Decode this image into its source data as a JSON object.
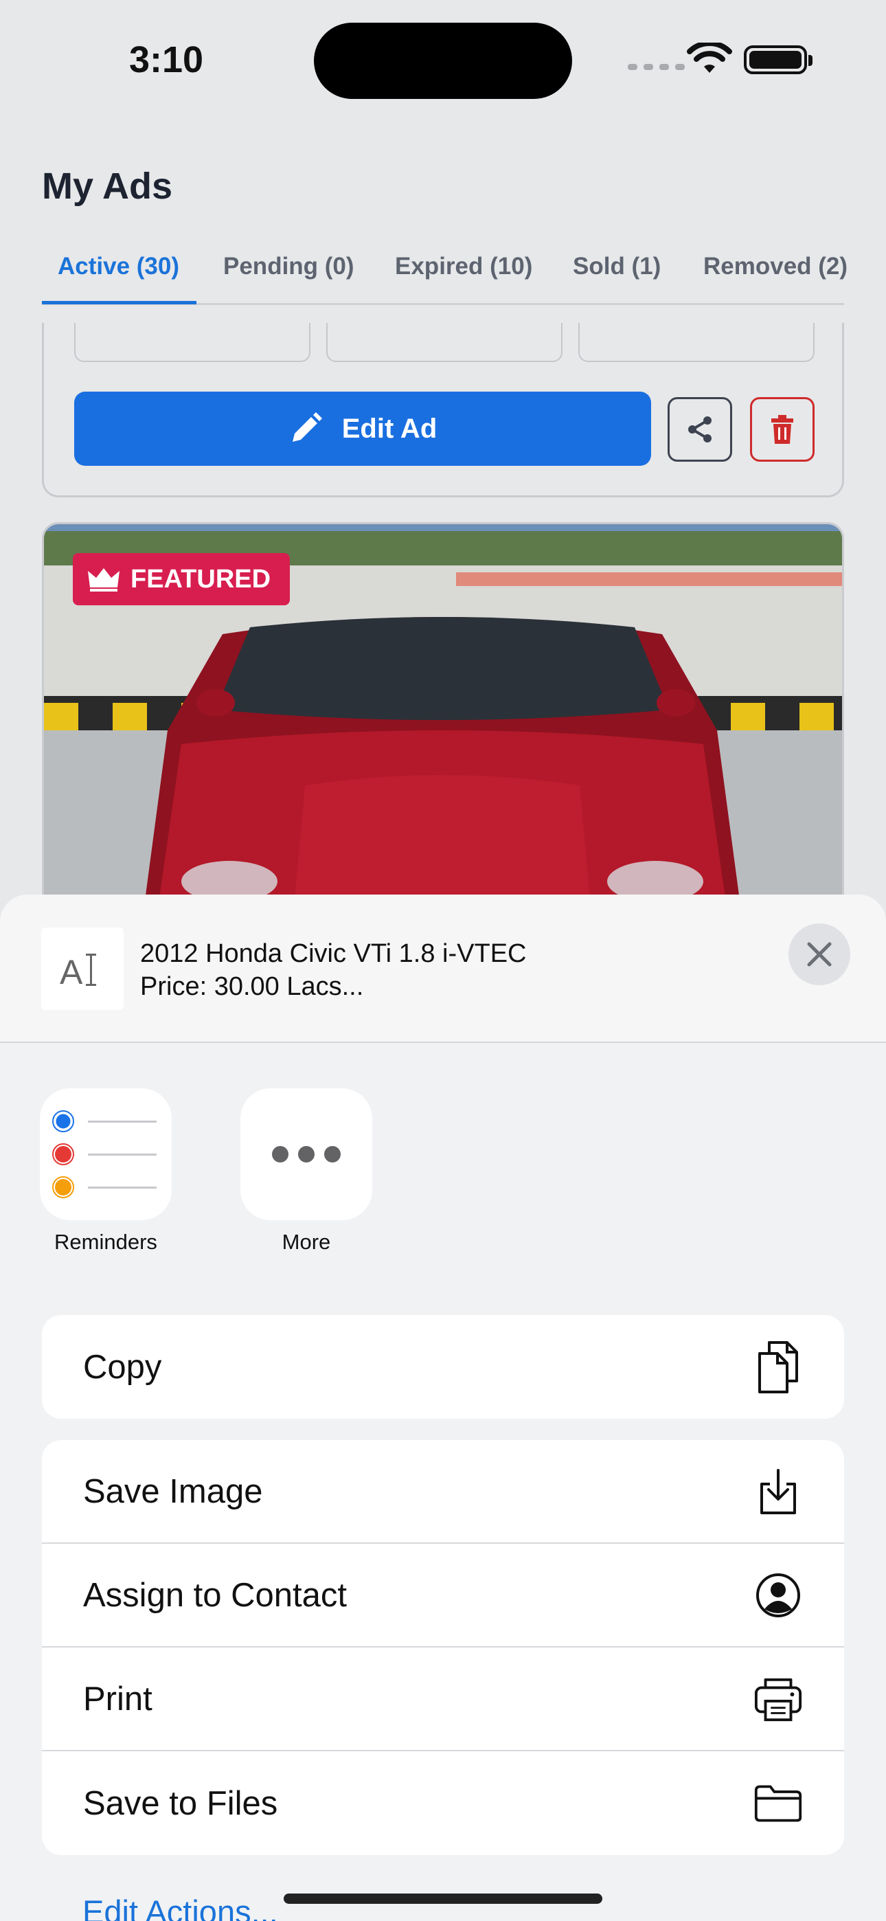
{
  "status_bar": {
    "time": "3:10"
  },
  "header": {
    "title": "My Ads",
    "tabs": [
      {
        "label": "Active (30)"
      },
      {
        "label": "Pending (0)"
      },
      {
        "label": "Expired (10)"
      },
      {
        "label": "Sold (1)"
      },
      {
        "label": "Removed (2)"
      }
    ]
  },
  "ad_card": {
    "edit_label": "Edit Ad",
    "share_icon": "share-icon",
    "delete_icon": "trash-icon"
  },
  "ad_card_2": {
    "badge": "FEATURED",
    "badge_icon": "crown-icon"
  },
  "share_sheet": {
    "preview_line1": "2012 Honda Civic VTi 1.8 i-VTEC",
    "preview_line2": "Price: 30.00 Lacs...",
    "apps": [
      {
        "label": "Reminders"
      },
      {
        "label": "More"
      }
    ],
    "actions": [
      {
        "label": "Copy",
        "icon": "copy-icon"
      },
      {
        "label": "Save Image",
        "icon": "download-icon"
      },
      {
        "label": "Assign to Contact",
        "icon": "contact-icon"
      },
      {
        "label": "Print",
        "icon": "printer-icon"
      },
      {
        "label": "Save to Files",
        "icon": "folder-icon"
      }
    ],
    "edit_actions": "Edit Actions..."
  },
  "colors": {
    "accent": "#1a73d9",
    "edit_button": "#1a6fe0",
    "featured": "#d71e4f",
    "delete": "#cf2b2b"
  }
}
